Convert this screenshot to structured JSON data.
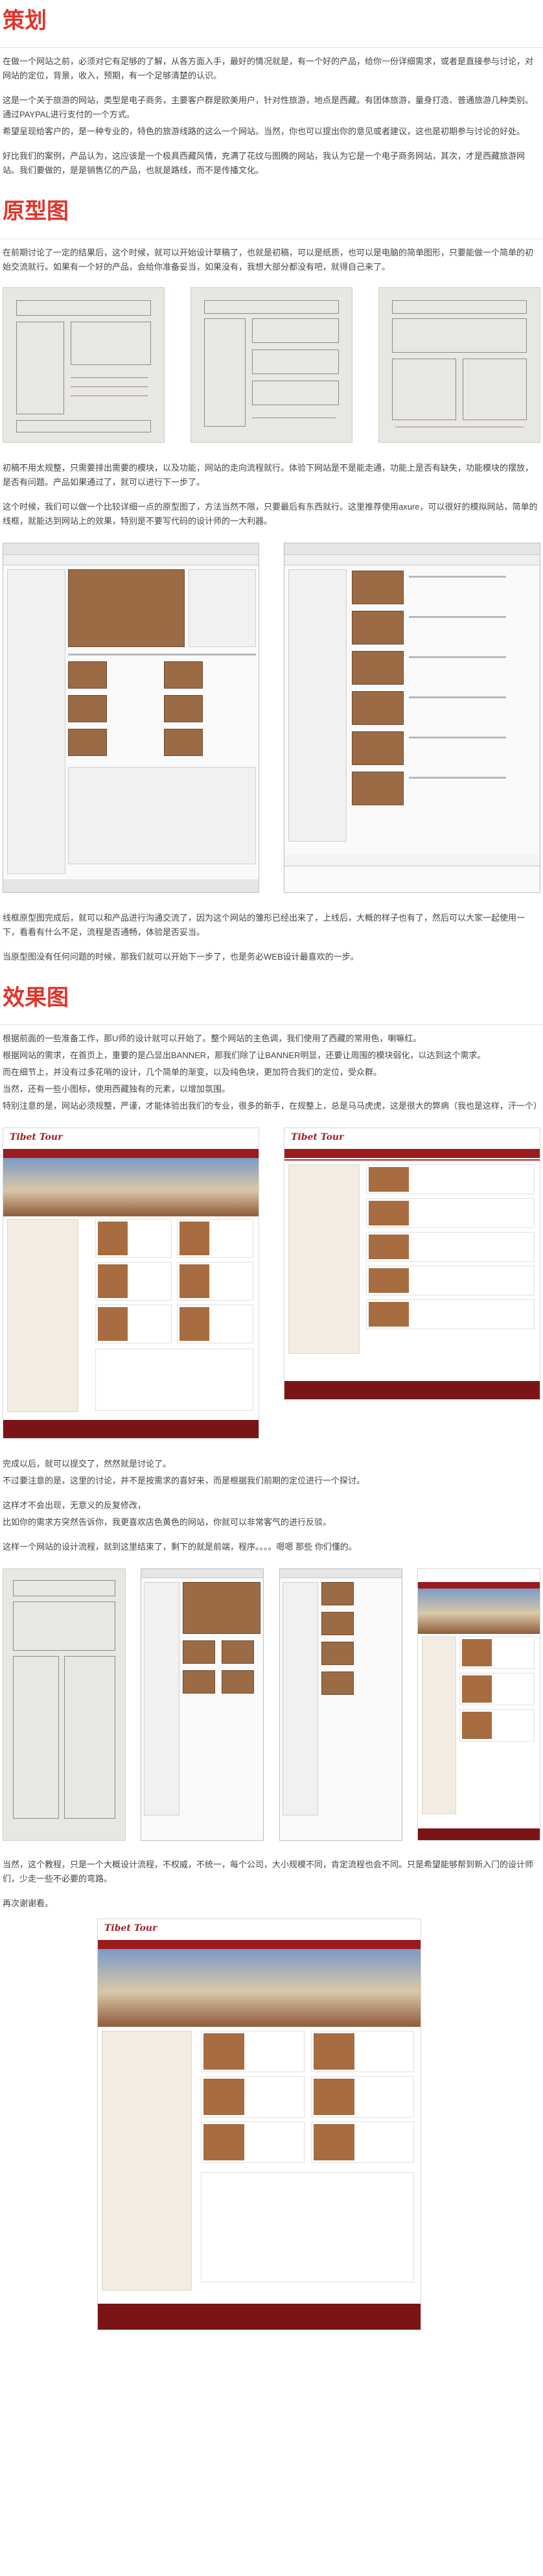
{
  "sections": {
    "planning": {
      "title": "策划",
      "paragraphs": [
        "在做一个网站之前，必须对它有足够的了解，从各方面入手，最好的情况就是，有一个好的产品，给你一份详细需求，或者是直接参与讨论，对网站的定位，背景，收入，预期，有一个足够清楚的认识。",
        "这是一个关于旅游的网站，类型是电子商务，主要客户群是欧美用户，针对性旅游，地点是西藏。有团体旅游，量身打造、普通旅游几种类别。通过PAYPAL进行支付的一个方式。",
        "希望呈现给客户的，是一种专业的，特色的旅游线路的这么一个网站。当然，你也可以提出你的意见或者建议，这也是初期参与讨论的好处。",
        "好比我们的案例，产品认为，这应该是一个极具西藏风情，充满了花纹与图腾的网站，我认为它是一个电子商务网站，其次，才是西藏旅游网站。我们要做的，是是销售亿的产品，也就是路线，而不是传播文化。"
      ]
    },
    "prototype": {
      "title": "原型图",
      "paragraphs": [
        "在前期讨论了一定的结果后，这个时候，就可以开始设计草稿了，也就是初稿，可以是纸质，也可以是电脑的简单图形，只要能做一个简单的初始交流就行。如果有一个好的产品，会给你准备妥当，如果没有，我想大部分都没有吧，就得自己来了。",
        "初稿不用太规整，只需要排出需要的模块，以及功能，网站的走向流程就行。体验下网站是不是能走通，功能上是否有缺失，功能模块的摆放，是否有问题。产品如果通过了，就可以进行下一步了。",
        "这个时候，我们可以做一个比较详细一点的原型图了，方法当然不限，只要最后有东西就行。这里推荐使用axure，可以很好的模拟网站，简单的线框，就能达到网站上的效果，特别是不要写代码的设计师的一大利器。",
        "线框原型图完成后，就可以和产品进行沟通交流了，因为这个网站的雏形已经出来了，上线后，大概的样子也有了，然后可以大家一起使用一下，看看有什么不足，流程是否通畅，体验是否妥当。",
        "当原型图没有任何问题的时候，那我们就可以开始下一步了，也是务必WEB设计最喜欢的一步。"
      ]
    },
    "effect": {
      "title": "效果图",
      "paragraphs": [
        "根据前面的一些准备工作，那U师的设计就可以开始了。整个网站的主色调，我们使用了西藏的常用色，喇嘛红。",
        "根据网站的需求，在首页上，重要的是凸显出BANNER，那我们除了让BANNER明显，还要让周围的模块弱化，以达到这个需求。",
        "而在细节上，并没有过多花哨的设计，几个简单的渐变，以及纯色块，更加符合我们的定位，受众群。",
        "当然，还有一些小图标，使用西藏独有的元素，以增加氛围。",
        "特别注意的是，网站必须规整，严谨，才能体验出我们的专业，很多的新手，在规整上，总是马马虎虎，这是很大的弊病（我也是这样，汗一个）",
        "完成以后，就可以提交了，然然就是讨论了。",
        "不过要注意的是，这里的讨论，并不是按需求的喜好来，而是根据我们前期的定位进行一个探讨。",
        "这样才不会出现，无意义的反复修改，",
        "比如你的需求方突然告诉你，我更喜欢店色黄色的网站，你就可以非常客气的进行反驳。",
        "这样一个网站的设计流程，就到这里结束了，剩下的就是前端，程序。。。。嗯嗯 那些 你们懂的。",
        "当然，这个教程，只是一个大概设计流程，不权威，不统一，每个公司，大小规模不同，肯定流程也会不同。只是希望能够帮到新入门的设计师们，少走一些不必要的弯路。",
        "再次谢谢看。"
      ]
    }
  },
  "mockups": {
    "logo_text": "Tibet Tour",
    "colors": {
      "accent": "#e0352b",
      "tibet_red": "#9c1b1d",
      "footer_red": "#7a1416"
    }
  }
}
